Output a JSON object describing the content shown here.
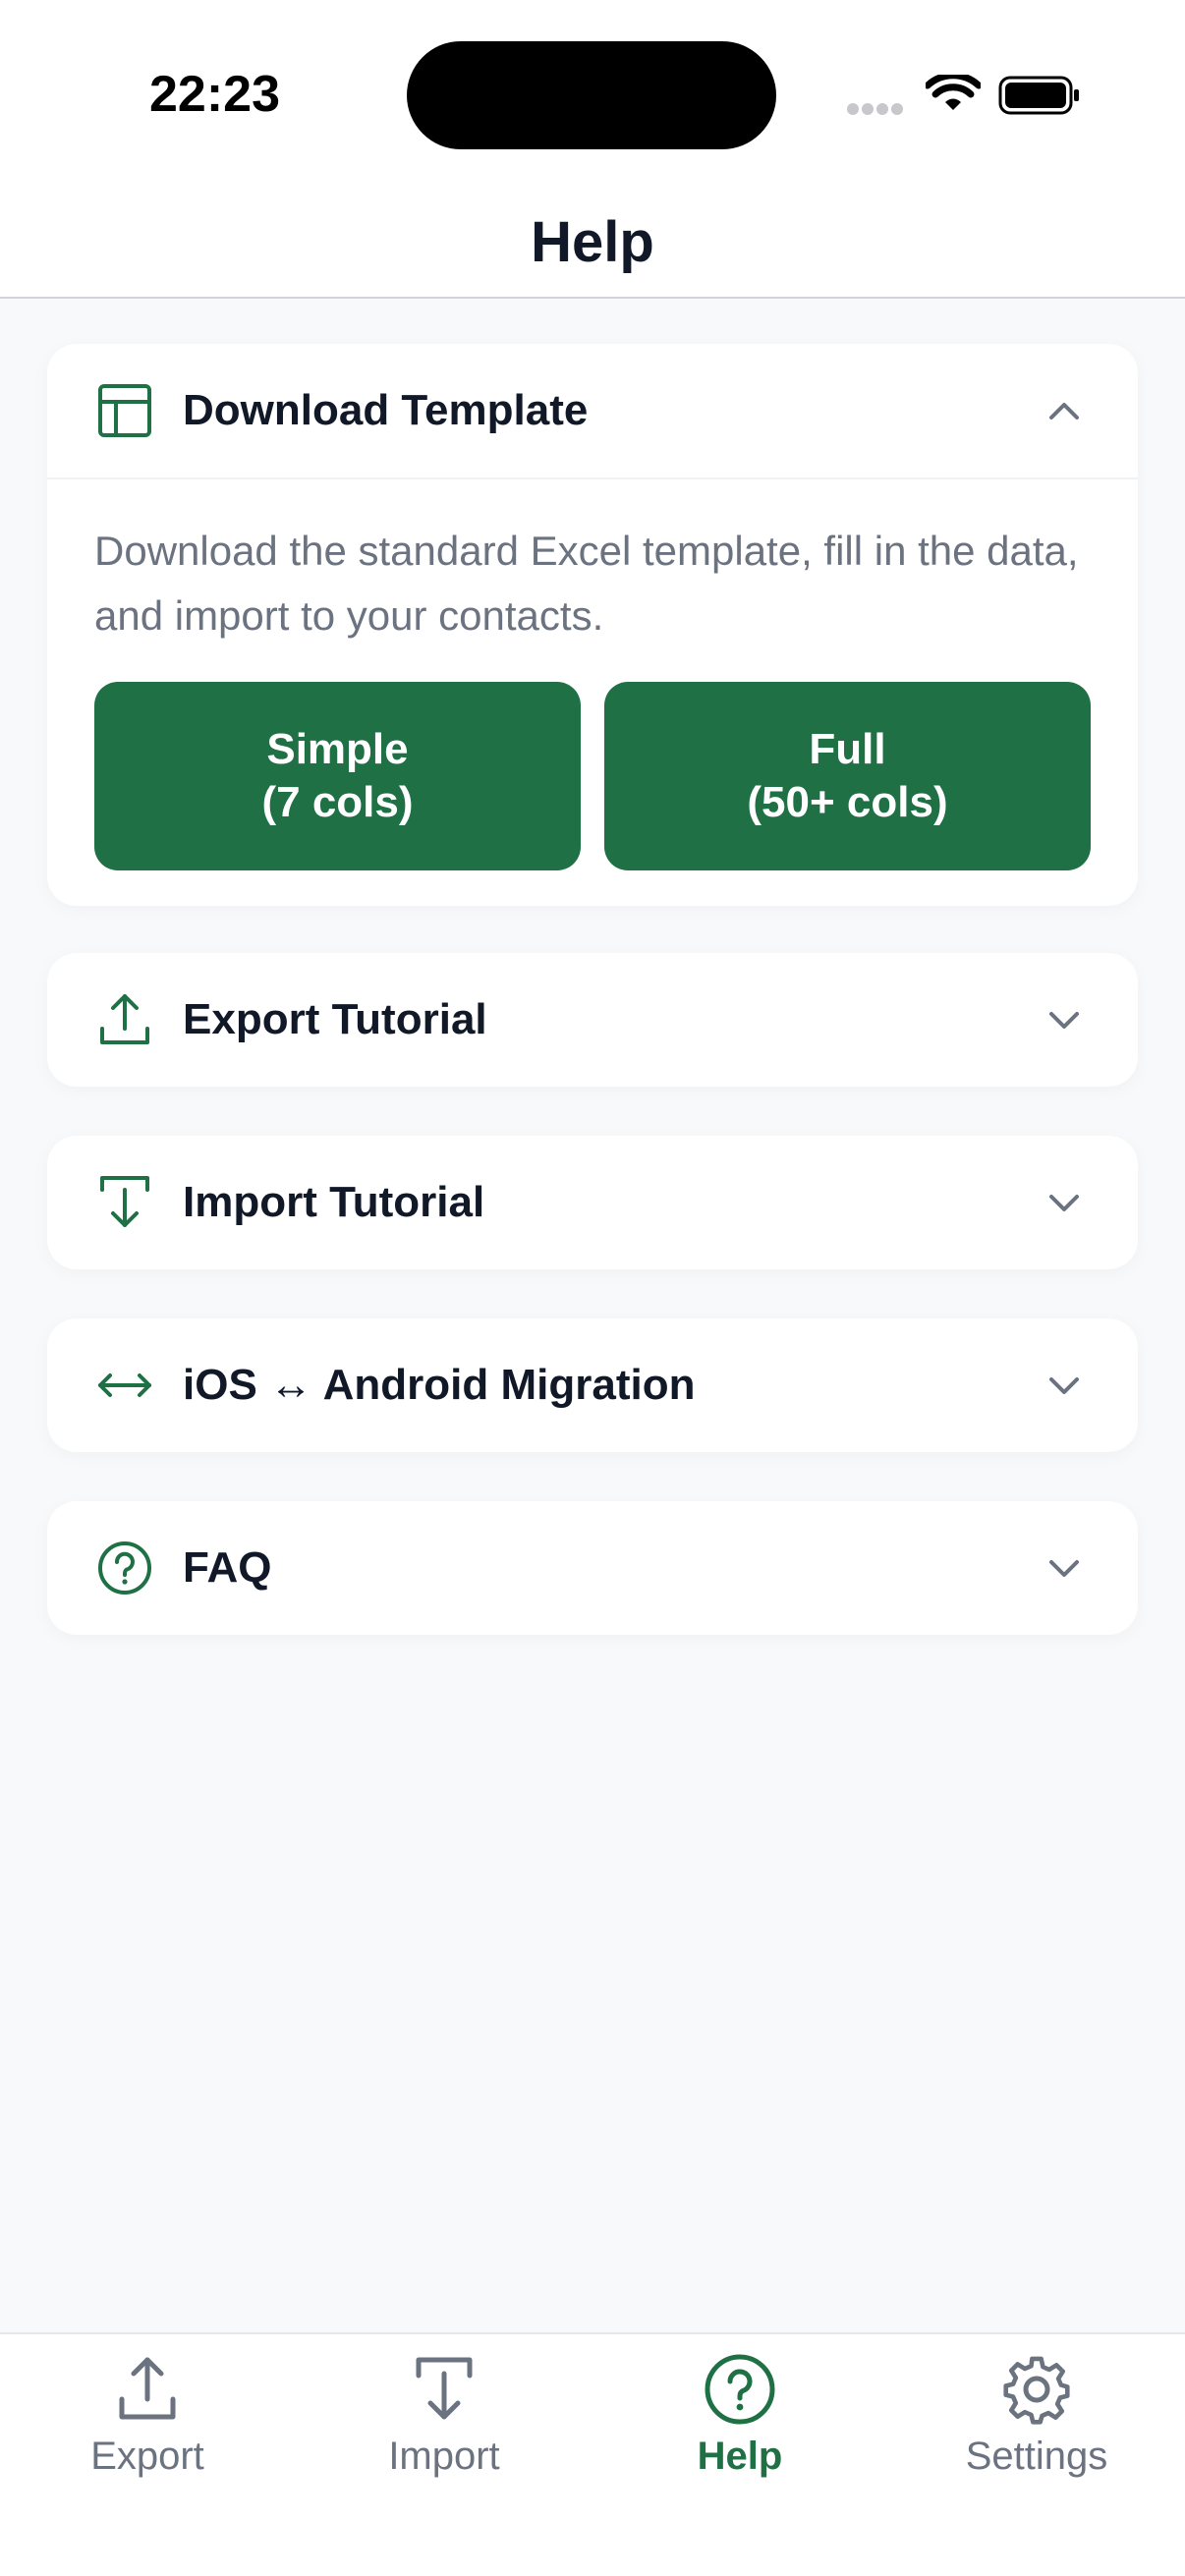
{
  "status_bar": {
    "time": "22:23"
  },
  "nav": {
    "title": "Help"
  },
  "sections": {
    "download": {
      "title": "Download Template",
      "description": "Download the standard Excel template, fill in the data, and import to your contacts.",
      "simple_line1": "Simple",
      "simple_line2": "(7 cols)",
      "full_line1": "Full",
      "full_line2": "(50+ cols)",
      "expanded": true
    },
    "export": {
      "title": "Export Tutorial"
    },
    "import": {
      "title": "Import Tutorial"
    },
    "migration": {
      "title": "iOS ↔ Android Migration"
    },
    "faq": {
      "title": "FAQ"
    }
  },
  "tabs": {
    "export": "Export",
    "import": "Import",
    "help": "Help",
    "settings": "Settings",
    "active": "help"
  },
  "colors": {
    "accent": "#1F7044",
    "background": "#F8F9FB",
    "text_primary": "#111827",
    "text_secondary": "#6B7280",
    "chevron": "#6B7280"
  },
  "icons": {
    "download": "table-icon",
    "export": "upload-icon",
    "import": "download-icon",
    "migration": "arrows-horizontal-icon",
    "faq": "question-circle-icon",
    "tab_settings": "gear-icon"
  }
}
